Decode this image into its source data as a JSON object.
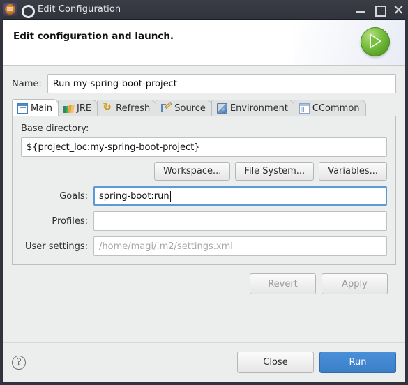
{
  "window": {
    "title": "Edit Configuration",
    "app_icon": "eclipse-gear-icon",
    "dialog_icon": "config-circle-icon",
    "controls": {
      "minimize": "minimize-icon",
      "maximize": "maximize-icon",
      "close": "close-icon"
    }
  },
  "banner": {
    "title": "Edit configuration and launch.",
    "icon": "green-run-ball-icon"
  },
  "name_field": {
    "label": "Name:",
    "value": "Run my-spring-boot-project"
  },
  "tabs": [
    {
      "label": "Main",
      "icon": "document-icon",
      "active": true,
      "mnemonic": ""
    },
    {
      "label": "JRE",
      "icon": "books-icon",
      "active": false,
      "mnemonic": ""
    },
    {
      "label": "Refresh",
      "icon": "refresh-icon",
      "active": false,
      "mnemonic": ""
    },
    {
      "label": "Source",
      "icon": "source-pencil-icon",
      "active": false,
      "mnemonic": ""
    },
    {
      "label": "Environment",
      "icon": "environment-monitor-icon",
      "active": false,
      "mnemonic": ""
    },
    {
      "label": "Common",
      "icon": "common-panel-icon",
      "active": false,
      "mnemonic": "C"
    }
  ],
  "main_tab": {
    "base_directory": {
      "label": "Base directory:",
      "value": "${project_loc:my-spring-boot-project}"
    },
    "dir_buttons": [
      {
        "label": "Workspace...",
        "name": "workspace-button"
      },
      {
        "label": "File System...",
        "name": "file-system-button"
      },
      {
        "label": "Variables...",
        "name": "variables-button"
      }
    ],
    "goals": {
      "label": "Goals:",
      "value": "spring-boot:run",
      "focused": true
    },
    "profiles": {
      "label": "Profiles:",
      "value": ""
    },
    "user_settings": {
      "label": "User settings:",
      "value": "",
      "placeholder": "/home/magi/.m2/settings.xml"
    }
  },
  "apply_buttons": {
    "revert": "Revert",
    "apply": "Apply",
    "disabled": true
  },
  "footer": {
    "help": "?",
    "close": "Close",
    "run": "Run"
  },
  "colors": {
    "titlebar": "#32343d",
    "dialog_bg": "#eceded",
    "accent_blue": "#3a7fc6",
    "focus_blue": "#5b9bd5",
    "run_green": "#7cc142",
    "placeholder_gray": "#a6a7a9"
  }
}
